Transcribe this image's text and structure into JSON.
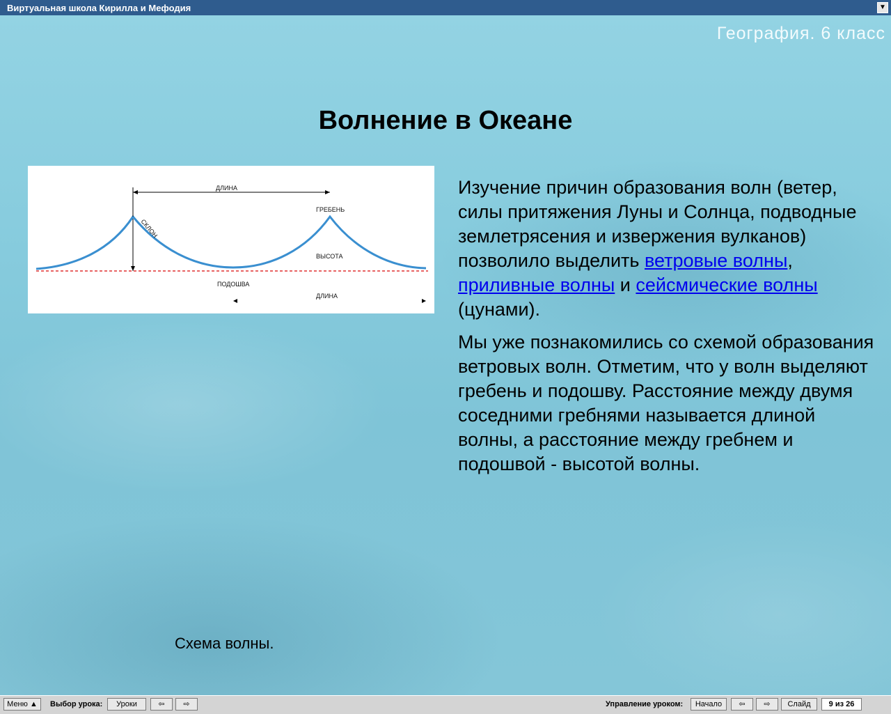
{
  "window": {
    "title": "Виртуальная школа Кирилла и Мефодия",
    "subject": "География. 6 класс"
  },
  "slide": {
    "title": "Волнение в Океане",
    "caption": "Схема волны.",
    "diagram_labels": {
      "length_top": "ДЛИНА",
      "crest": "ГРЕБЕНЬ",
      "slope": "СКЛОН",
      "height": "ВЫСОТА",
      "trough": "ПОДОШВА",
      "length_bottom": "ДЛИНА"
    },
    "paragraph1": {
      "p1": "Изучение причин образования волн (ветер, силы притяжения Луны и Солнца, подводные землетрясения и извержения вулканов) позволило выделить ",
      "link1": "ветровые волны",
      "sep1": ",",
      "link2": "приливные волны",
      "sep2": " и",
      "link3": "сейсмические волны",
      "tail": " (цунами)."
    },
    "paragraph2": "Мы уже познакомились со схемой образования ветровых волн. Отметим, что у волн выделяют гребень и подошву. Расстояние между двумя соседними гребнями называется длиной волны, а расстояние между гребнем и подошвой - высотой волны."
  },
  "toolbar": {
    "menu": "Меню",
    "lesson_choice_label": "Выбор урока:",
    "lessons": "Уроки",
    "control_label": "Управление уроком:",
    "start": "Начало",
    "slide": "Слайд",
    "counter": "9 из 26"
  },
  "colors": {
    "titlebar": "#2f5c8e",
    "wave": "#3a8fd0",
    "baseline": "#e03030",
    "link": "#0000ee"
  }
}
